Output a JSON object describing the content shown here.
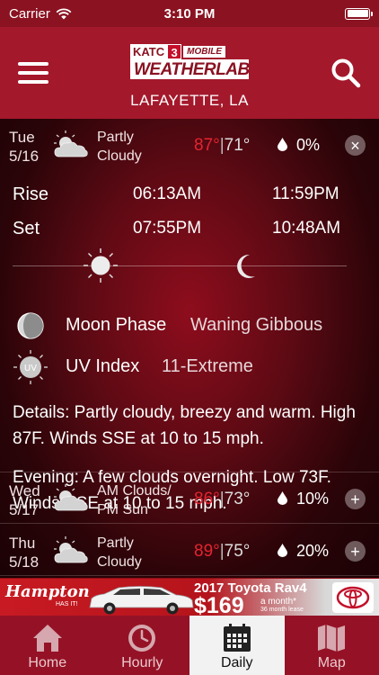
{
  "status": {
    "carrier": "Carrier",
    "time": "3:10 PM"
  },
  "header": {
    "logo_station": "KATC",
    "logo_number": "3",
    "logo_mobile": "MOBILE",
    "logo_main": "WEATHERLAB",
    "location": "LAFAYETTE, LA"
  },
  "today": {
    "day": "Tue",
    "date": "5/16",
    "cond_line1": "Partly",
    "cond_line2": "Cloudy",
    "hi": "87°",
    "sep": "|",
    "lo": "71°",
    "pop": "0%",
    "toggle": "×"
  },
  "detail": {
    "rise_label": "Rise",
    "set_label": "Set",
    "sunrise": "06:13AM",
    "sunset": "07:55PM",
    "moonrise": "11:59PM",
    "moonset": "10:48AM",
    "moon_phase_label": "Moon Phase",
    "moon_phase_value": "Waning Gibbous",
    "uv_label": "UV Index",
    "uv_value": "11-Extreme",
    "uv_icon_text": "UV",
    "details_1": "Details: Partly cloudy, breezy and warm. High 87F. Winds SSE at 10 to 15 mph.",
    "details_2": "Evening: A few clouds overnight. Low 73F. Winds SSE at 10 to 15 mph."
  },
  "days": [
    {
      "day": "Wed",
      "date": "5/17",
      "cond_line1": "AM Clouds/",
      "cond_line2": "PM Sun",
      "hi": "86°",
      "sep": "|",
      "lo": "73°",
      "pop": "10%",
      "toggle": "+"
    },
    {
      "day": "Thu",
      "date": "5/18",
      "cond_line1": "Partly",
      "cond_line2": "Cloudy",
      "hi": "89°",
      "sep": "|",
      "lo": "75°",
      "pop": "20%",
      "toggle": "+"
    }
  ],
  "ad": {
    "dealer": "Hampton",
    "dealer_sub": "HAS IT!",
    "title": "2017 Toyota Rav4",
    "price": "$169",
    "per_month": "a month*",
    "lease": "36 month lease"
  },
  "tabs": [
    {
      "label": "Home",
      "icon": "home-icon"
    },
    {
      "label": "Hourly",
      "icon": "clock-icon"
    },
    {
      "label": "Daily",
      "icon": "calendar-icon"
    },
    {
      "label": "Map",
      "icon": "map-icon"
    }
  ],
  "colors": {
    "header": "#a4182b",
    "hi_temp": "#e4242f",
    "tabbar": "#951226"
  }
}
